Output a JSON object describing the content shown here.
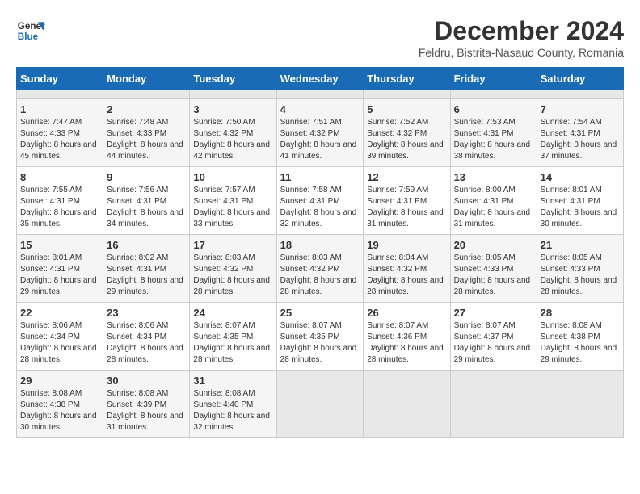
{
  "logo": {
    "text_general": "General",
    "text_blue": "Blue"
  },
  "header": {
    "title": "December 2024",
    "subtitle": "Feldru, Bistrita-Nasaud County, Romania"
  },
  "calendar": {
    "days_of_week": [
      "Sunday",
      "Monday",
      "Tuesday",
      "Wednesday",
      "Thursday",
      "Friday",
      "Saturday"
    ],
    "weeks": [
      [
        {
          "day": "",
          "empty": true
        },
        {
          "day": "",
          "empty": true
        },
        {
          "day": "",
          "empty": true
        },
        {
          "day": "",
          "empty": true
        },
        {
          "day": "",
          "empty": true
        },
        {
          "day": "",
          "empty": true
        },
        {
          "day": "",
          "empty": true
        }
      ],
      [
        {
          "day": "1",
          "sunrise": "Sunrise: 7:47 AM",
          "sunset": "Sunset: 4:33 PM",
          "daylight": "Daylight: 8 hours and 45 minutes."
        },
        {
          "day": "2",
          "sunrise": "Sunrise: 7:48 AM",
          "sunset": "Sunset: 4:33 PM",
          "daylight": "Daylight: 8 hours and 44 minutes."
        },
        {
          "day": "3",
          "sunrise": "Sunrise: 7:50 AM",
          "sunset": "Sunset: 4:32 PM",
          "daylight": "Daylight: 8 hours and 42 minutes."
        },
        {
          "day": "4",
          "sunrise": "Sunrise: 7:51 AM",
          "sunset": "Sunset: 4:32 PM",
          "daylight": "Daylight: 8 hours and 41 minutes."
        },
        {
          "day": "5",
          "sunrise": "Sunrise: 7:52 AM",
          "sunset": "Sunset: 4:32 PM",
          "daylight": "Daylight: 8 hours and 39 minutes."
        },
        {
          "day": "6",
          "sunrise": "Sunrise: 7:53 AM",
          "sunset": "Sunset: 4:31 PM",
          "daylight": "Daylight: 8 hours and 38 minutes."
        },
        {
          "day": "7",
          "sunrise": "Sunrise: 7:54 AM",
          "sunset": "Sunset: 4:31 PM",
          "daylight": "Daylight: 8 hours and 37 minutes."
        }
      ],
      [
        {
          "day": "8",
          "sunrise": "Sunrise: 7:55 AM",
          "sunset": "Sunset: 4:31 PM",
          "daylight": "Daylight: 8 hours and 35 minutes."
        },
        {
          "day": "9",
          "sunrise": "Sunrise: 7:56 AM",
          "sunset": "Sunset: 4:31 PM",
          "daylight": "Daylight: 8 hours and 34 minutes."
        },
        {
          "day": "10",
          "sunrise": "Sunrise: 7:57 AM",
          "sunset": "Sunset: 4:31 PM",
          "daylight": "Daylight: 8 hours and 33 minutes."
        },
        {
          "day": "11",
          "sunrise": "Sunrise: 7:58 AM",
          "sunset": "Sunset: 4:31 PM",
          "daylight": "Daylight: 8 hours and 32 minutes."
        },
        {
          "day": "12",
          "sunrise": "Sunrise: 7:59 AM",
          "sunset": "Sunset: 4:31 PM",
          "daylight": "Daylight: 8 hours and 31 minutes."
        },
        {
          "day": "13",
          "sunrise": "Sunrise: 8:00 AM",
          "sunset": "Sunset: 4:31 PM",
          "daylight": "Daylight: 8 hours and 31 minutes."
        },
        {
          "day": "14",
          "sunrise": "Sunrise: 8:01 AM",
          "sunset": "Sunset: 4:31 PM",
          "daylight": "Daylight: 8 hours and 30 minutes."
        }
      ],
      [
        {
          "day": "15",
          "sunrise": "Sunrise: 8:01 AM",
          "sunset": "Sunset: 4:31 PM",
          "daylight": "Daylight: 8 hours and 29 minutes."
        },
        {
          "day": "16",
          "sunrise": "Sunrise: 8:02 AM",
          "sunset": "Sunset: 4:31 PM",
          "daylight": "Daylight: 8 hours and 29 minutes."
        },
        {
          "day": "17",
          "sunrise": "Sunrise: 8:03 AM",
          "sunset": "Sunset: 4:32 PM",
          "daylight": "Daylight: 8 hours and 28 minutes."
        },
        {
          "day": "18",
          "sunrise": "Sunrise: 8:03 AM",
          "sunset": "Sunset: 4:32 PM",
          "daylight": "Daylight: 8 hours and 28 minutes."
        },
        {
          "day": "19",
          "sunrise": "Sunrise: 8:04 AM",
          "sunset": "Sunset: 4:32 PM",
          "daylight": "Daylight: 8 hours and 28 minutes."
        },
        {
          "day": "20",
          "sunrise": "Sunrise: 8:05 AM",
          "sunset": "Sunset: 4:33 PM",
          "daylight": "Daylight: 8 hours and 28 minutes."
        },
        {
          "day": "21",
          "sunrise": "Sunrise: 8:05 AM",
          "sunset": "Sunset: 4:33 PM",
          "daylight": "Daylight: 8 hours and 28 minutes."
        }
      ],
      [
        {
          "day": "22",
          "sunrise": "Sunrise: 8:06 AM",
          "sunset": "Sunset: 4:34 PM",
          "daylight": "Daylight: 8 hours and 28 minutes."
        },
        {
          "day": "23",
          "sunrise": "Sunrise: 8:06 AM",
          "sunset": "Sunset: 4:34 PM",
          "daylight": "Daylight: 8 hours and 28 minutes."
        },
        {
          "day": "24",
          "sunrise": "Sunrise: 8:07 AM",
          "sunset": "Sunset: 4:35 PM",
          "daylight": "Daylight: 8 hours and 28 minutes."
        },
        {
          "day": "25",
          "sunrise": "Sunrise: 8:07 AM",
          "sunset": "Sunset: 4:35 PM",
          "daylight": "Daylight: 8 hours and 28 minutes."
        },
        {
          "day": "26",
          "sunrise": "Sunrise: 8:07 AM",
          "sunset": "Sunset: 4:36 PM",
          "daylight": "Daylight: 8 hours and 28 minutes."
        },
        {
          "day": "27",
          "sunrise": "Sunrise: 8:07 AM",
          "sunset": "Sunset: 4:37 PM",
          "daylight": "Daylight: 8 hours and 29 minutes."
        },
        {
          "day": "28",
          "sunrise": "Sunrise: 8:08 AM",
          "sunset": "Sunset: 4:38 PM",
          "daylight": "Daylight: 8 hours and 29 minutes."
        }
      ],
      [
        {
          "day": "29",
          "sunrise": "Sunrise: 8:08 AM",
          "sunset": "Sunset: 4:38 PM",
          "daylight": "Daylight: 8 hours and 30 minutes."
        },
        {
          "day": "30",
          "sunrise": "Sunrise: 8:08 AM",
          "sunset": "Sunset: 4:39 PM",
          "daylight": "Daylight: 8 hours and 31 minutes."
        },
        {
          "day": "31",
          "sunrise": "Sunrise: 8:08 AM",
          "sunset": "Sunset: 4:40 PM",
          "daylight": "Daylight: 8 hours and 32 minutes."
        },
        {
          "day": "",
          "empty": true
        },
        {
          "day": "",
          "empty": true
        },
        {
          "day": "",
          "empty": true
        },
        {
          "day": "",
          "empty": true
        }
      ]
    ]
  }
}
